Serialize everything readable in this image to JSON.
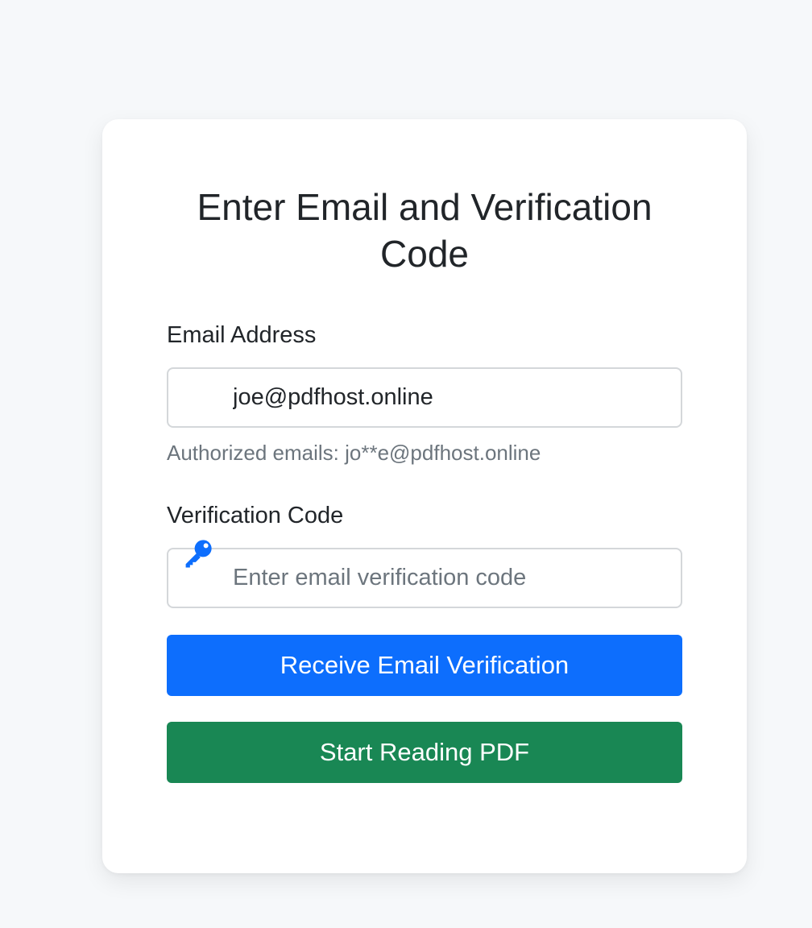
{
  "form": {
    "title": "Enter Email and Verification Code",
    "email_label": "Email Address",
    "email_value": "joe@pdfhost.online",
    "authorized_hint": "Authorized emails: jo**e@pdfhost.online",
    "code_label": "Verification Code",
    "code_placeholder": "Enter email verification code",
    "code_value": "",
    "code_icon": "key-icon",
    "receive_button": "Receive Email Verification",
    "start_button": "Start Reading PDF"
  },
  "colors": {
    "primary": "#0d6efd",
    "success": "#198754",
    "icon": "#0d6efd",
    "page_background": "#f6f8fa"
  }
}
